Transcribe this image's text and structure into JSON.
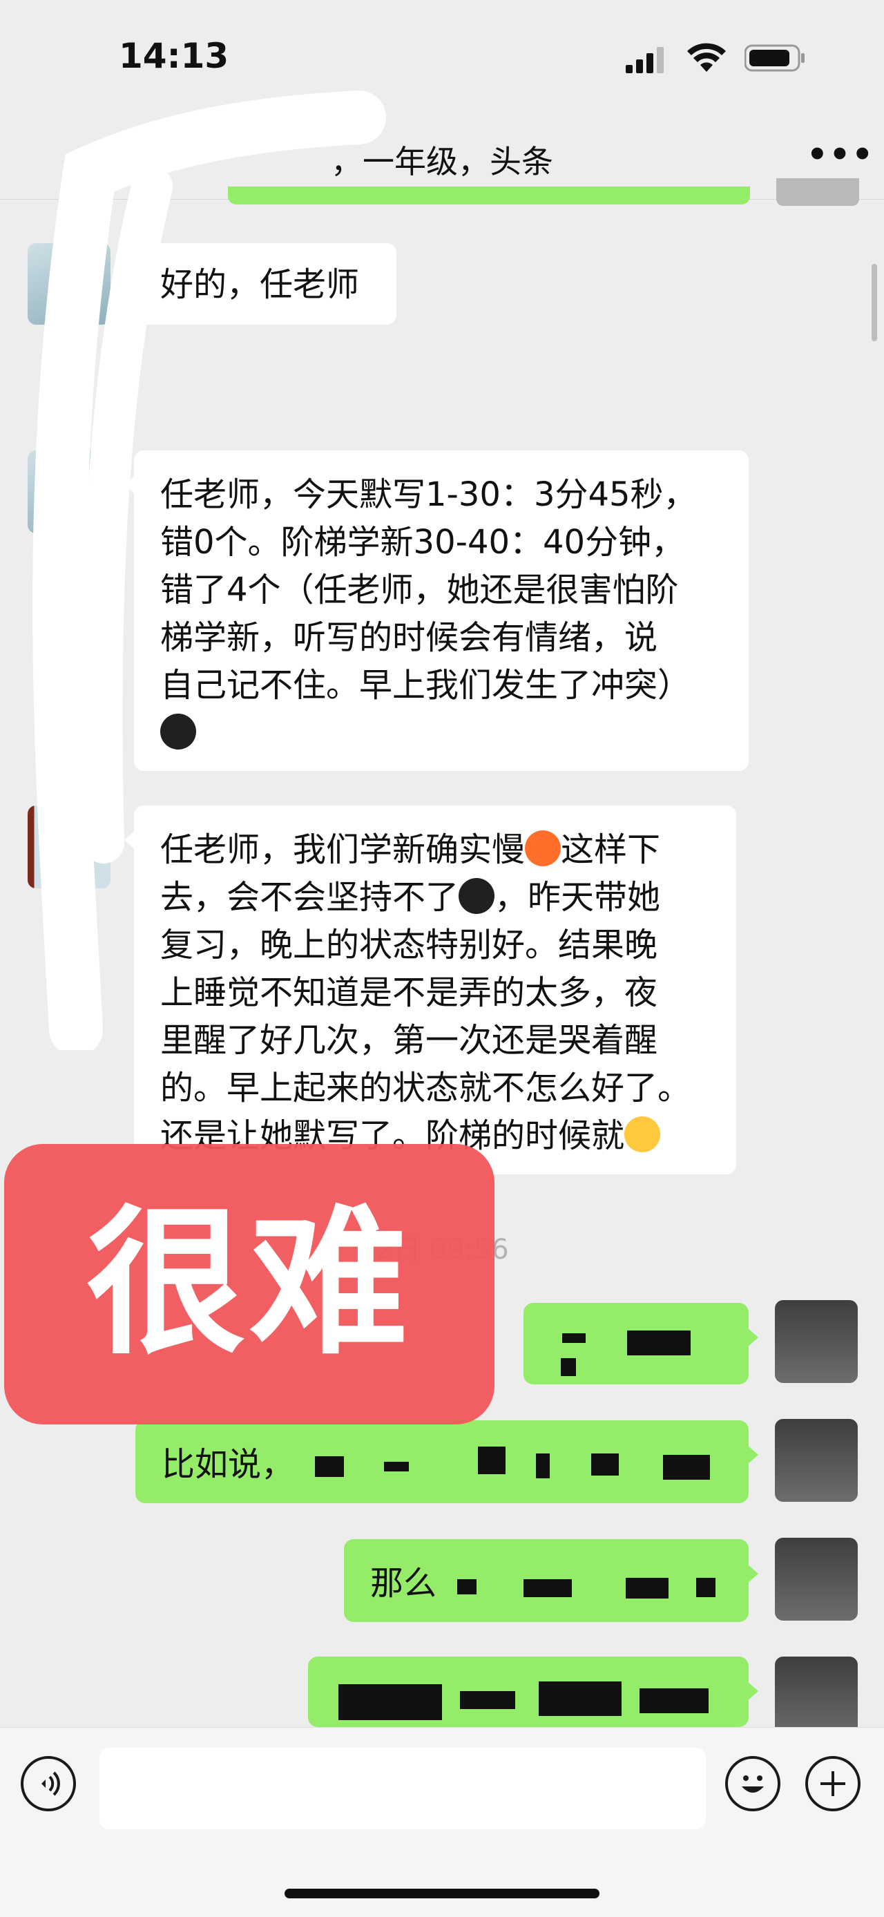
{
  "status_bar": {
    "time": "14:13"
  },
  "header": {
    "title": "，一年级，头条",
    "more_icon": "more-dots-icon"
  },
  "messages": [
    {
      "side": "left",
      "text": "好的，任老师"
    },
    {
      "side": "left",
      "text": "任老师，今天默写1-30：3分45秒，\n错0个。阶梯学新30-40：40分钟，\n错了4个（任老师，她还是很害怕阶\n梯学新，听写的时候会有情绪，说\n自己记不住。早上我们发生了冲突）",
      "emoji_end": "crying-face-icon"
    },
    {
      "side": "left",
      "line1_a": "任老师，我们学新确实慢",
      "line1_b": "这样下",
      "line2_a": "去，会不会坚持不了",
      "line2_b": "，昨天带她",
      "rest": "复习，晚上的状态特别好。结果晚\n上睡觉不知道是不是弄的太多，夜\n里醒了好几次，第一次还是哭着醒\n的。早上起来的状态就不怎么好了。",
      "last_a": "还是让她默写了。阶梯的时候就"
    },
    {
      "side": "right",
      "text": ""
    },
    {
      "side": "right",
      "text": "比如说，"
    },
    {
      "side": "right",
      "text": "那么"
    },
    {
      "side": "right",
      "text": ""
    }
  ],
  "timestamp": "2日 09:56",
  "sticker": {
    "text": "很难",
    "color": "#f2575b"
  },
  "input_bar": {
    "voice_icon": "voice-icon",
    "emoji_icon": "smiley-icon",
    "plus_icon": "plus-icon"
  },
  "colors": {
    "background": "#ededed",
    "my_bubble": "#95ec69",
    "their_bubble": "#ffffff"
  }
}
